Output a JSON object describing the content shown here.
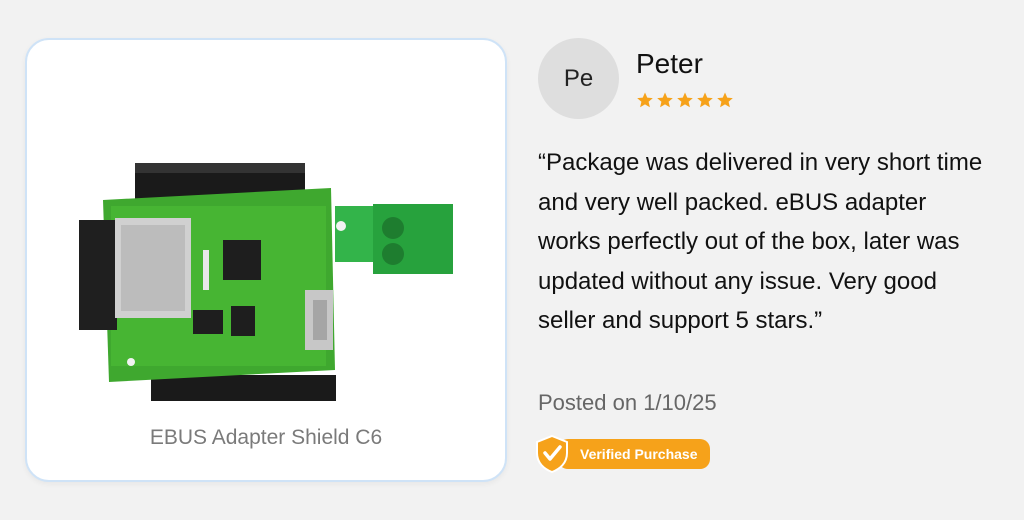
{
  "product": {
    "name": "EBUS Adapter Shield C6",
    "image_icon": "pcb-board-icon"
  },
  "reviewer": {
    "initials": "Pe",
    "name": "Peter",
    "rating": 5,
    "rating_max": 5
  },
  "review": {
    "text": "“Package was delivered in very short time and very well packed. eBUS adapter works perfectly out of the box, later was updated without any issue. Very good seller and support 5 stars.”",
    "posted": "Posted on 1/10/25",
    "badge": "Verified Purchase"
  },
  "colors": {
    "star": "#f6a21a",
    "badge": "#f6a21a",
    "card_border": "#cfe3f7"
  }
}
